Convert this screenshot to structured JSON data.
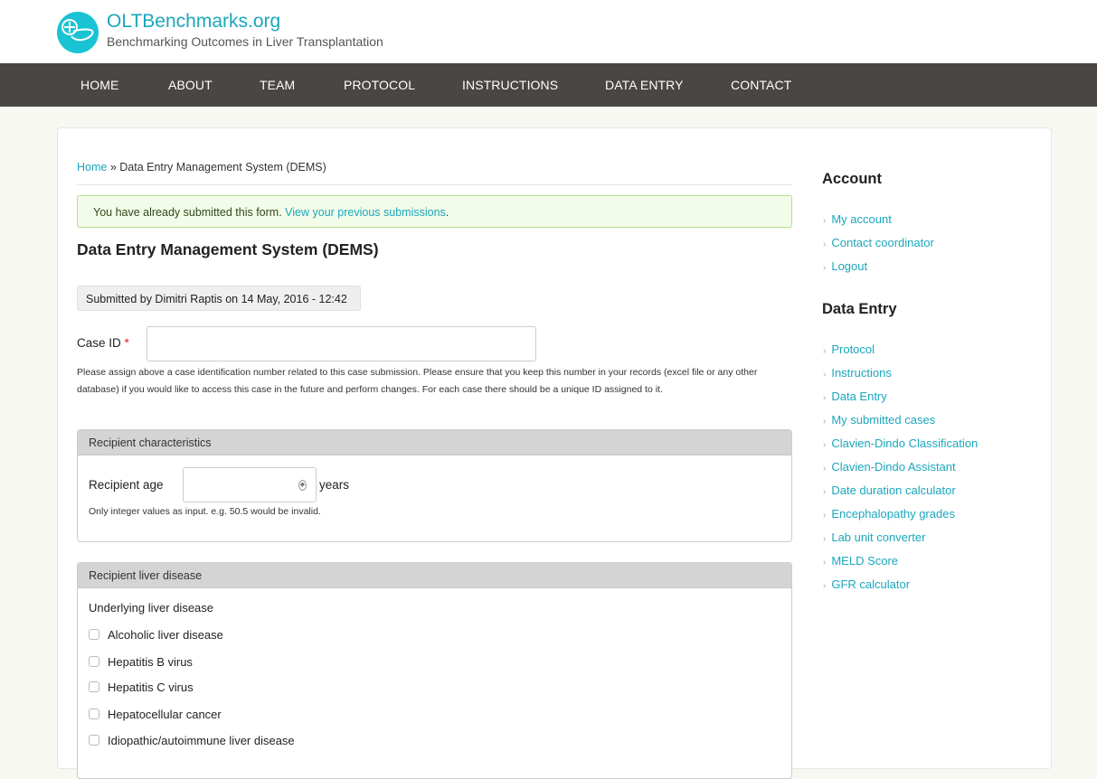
{
  "site": {
    "name": "OLTBenchmarks.org",
    "slogan": "Benchmarking Outcomes in Liver Transplantation"
  },
  "nav": [
    "HOME",
    "ABOUT",
    "TEAM",
    "PROTOCOL",
    "INSTRUCTIONS",
    "DATA ENTRY",
    "CONTACT"
  ],
  "breadcrumb": {
    "home": "Home",
    "separator": " » ",
    "current": "Data Entry Management System (DEMS)"
  },
  "status": {
    "text": "You have already submitted this form. ",
    "link": "View your previous submissions",
    "suffix": "."
  },
  "page_title": "Data Entry Management System (DEMS)",
  "submitted": "Submitted by Dimitri Raptis on 14 May, 2016 - 12:42",
  "case_id": {
    "label": "Case ID",
    "required_mark": "*",
    "value": "",
    "description": "Please assign above a case identification number related to this case submission. Please ensure that you keep this number in your records (excel file or any other database) if you would like to access this case in the future and perform changes. For each case there should be a unique ID assigned to it."
  },
  "recipient_characteristics": {
    "legend": "Recipient characteristics",
    "age_label": "Recipient age",
    "age_value": "",
    "unit": "years",
    "help": "Only integer values as input. e.g. 50.5 would be invalid."
  },
  "recipient_liver_disease": {
    "legend": "Recipient liver disease",
    "subtitle": "Underlying liver disease",
    "options": [
      "Alcoholic liver disease",
      "Hepatitis B virus",
      "Hepatitis C virus",
      "Hepatocellular cancer",
      "Idiopathic/autoimmune liver disease"
    ]
  },
  "sidebar": {
    "account": {
      "title": "Account",
      "links": [
        "My account",
        "Contact coordinator",
        "Logout"
      ]
    },
    "data_entry": {
      "title": "Data Entry",
      "links": [
        "Protocol",
        "Instructions",
        "Data Entry",
        "My submitted cases",
        "Clavien-Dindo Classification",
        "Clavien-Dindo Assistant",
        "Date duration calculator",
        "Encephalopathy grades",
        "Lab unit converter",
        "MELD Score",
        "GFR calculator"
      ]
    }
  },
  "icons": {
    "logo": "liver-logo-icon",
    "list_arrow": "chevron-right-icon",
    "spinner": "spinner-icon"
  },
  "colors": {
    "accent": "#1aa7bd",
    "navbar": "#4a4643",
    "status_bg": "#f3fbe9",
    "status_border": "#b6e08c"
  }
}
